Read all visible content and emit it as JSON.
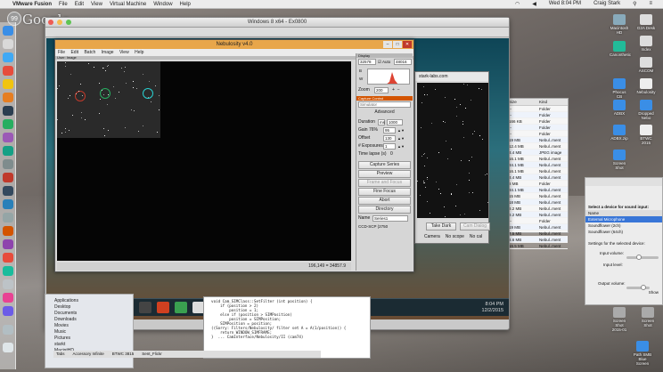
{
  "menubar": {
    "apple": "",
    "items": [
      "VMware Fusion",
      "File",
      "Edit",
      "View",
      "Virtual Machine",
      "Window",
      "Help"
    ],
    "clock": "Wed 8:04 PM",
    "user": "Craig Stark"
  },
  "hangouts": {
    "badge": "99",
    "logo": "Google"
  },
  "vm_window": {
    "title": "Windows 8 x64 - Ex0800"
  },
  "nebulosity": {
    "title": "Nebulosity v4.0",
    "menu": [
      "File",
      "Edit",
      "Batch",
      "Image",
      "View",
      "Help"
    ],
    "subbar": "User: Image",
    "status": "196,149 = 34857.9",
    "display": {
      "header": "Display",
      "black": "32578",
      "white": "48016",
      "auto_label": "Auto",
      "auto_checked": true,
      "b_label": "B",
      "w_label": "W",
      "zoom_label": "Zoom",
      "zoom": "200"
    },
    "capture": {
      "header": "Capture Control",
      "camera": "Simulator",
      "advanced": "Advanced",
      "duration_label": "Duration",
      "duration_unit": "ms",
      "duration": "1000",
      "gain_label": "Gain 76%",
      "gain": "95",
      "offset_label": "Offset",
      "offset": "130",
      "exposures_label": "# Exposures",
      "exposures": "1",
      "timelapse_label": "Time lapse (s)",
      "timelapse": "0",
      "buttons": [
        "Capture Series",
        "Preview",
        "Frame and Focus",
        "Fine Focus",
        "Abort",
        "Directory"
      ],
      "disabled_buttons": [
        "Frame and Focus"
      ],
      "name_label": "Name",
      "name": "Series1",
      "camera_info": "CCD-SCP (2750"
    }
  },
  "otherwin": {
    "title": "stark-labs.com",
    "buttons": [
      "Take Dark",
      "Cam Dialog"
    ],
    "status": [
      "Camera",
      "No scope",
      "No cal"
    ]
  },
  "finder": {
    "cols": [
      "Size",
      "Kind"
    ],
    "rows": [
      [
        "--",
        "Folder"
      ],
      [
        "--",
        "Folder"
      ],
      [
        "166 KB",
        "Folder"
      ],
      [
        "--",
        "Folder"
      ],
      [
        "--",
        "Folder"
      ],
      [
        "19 MB",
        "Nebul..ment"
      ],
      [
        "12.4 MB",
        "Nebul..ment"
      ],
      [
        "3.4 MB",
        "JPEG image"
      ],
      [
        "16.1 MB",
        "Nebul..ment"
      ],
      [
        "34.1 MB",
        "Nebul..ment"
      ],
      [
        "16.1 MB",
        "Nebul..ment"
      ],
      [
        "3.4 MB",
        "Nebul..ment"
      ],
      [
        "8 MB",
        "Folder"
      ],
      [
        "34.1 MB",
        "Nebul..ment"
      ],
      [
        "15 MB",
        "Nebul..ment"
      ],
      [
        "18 MB",
        "Nebul..ment"
      ],
      [
        "8.2 MB",
        "Nebul..ment"
      ],
      [
        "8.2 MB",
        "Nebul..ment"
      ],
      [
        "--",
        "Folder"
      ],
      [
        "19 MB",
        "Nebul..ment"
      ],
      [
        "7.5 MB",
        "Nebul..ment"
      ],
      [
        "8.6 MB",
        "Nebul..ment"
      ],
      [
        "16.5 MB",
        "Nebul..ment"
      ]
    ]
  },
  "sound": {
    "select": "Select a device for sound input:",
    "col_name": "Name",
    "devices": [
      "External Microphone",
      "Soundflower (2ch)",
      "Soundflower (64ch)"
    ],
    "settings": "Settings for the selected device:",
    "input_volume": "Input volume:",
    "input_level": "Input level:",
    "output_volume": "Output volume:",
    "show": "Show",
    "input_volume_value": 0.3,
    "output_volume_value": 0.6
  },
  "code_lines": [
    "  void Cam_SIMClass::SetFilter (int position) {",
    "      if (position > 2)",
    "          position = 1;",
    "      else if (position > SIMPosition)",
    "          position = SIMPosition;",
    "      SIMPosition = position;",
    "  ((Sorry: Filters/Nebulosity/ filter set A = A(1/position)) {",
    "      return WINDOW_SIMFRAME;",
    "  }  ... CamInterface/Nebulosity/II (cam74)"
  ],
  "sidebar": [
    "Applications",
    "Desktop",
    "Documents",
    "Downloads",
    "Movies",
    "Music",
    "Pictures",
    "starkt",
    "MacintHD"
  ],
  "tabs": [
    "Tabs",
    "Accessory Infinite",
    "BTWC 3815",
    "Sent_Flickr"
  ],
  "desktop_icons": [
    "Macintosh HD",
    "G2A Desk",
    "Index",
    "Canonthetic",
    "ASCOM",
    "Phocus CB",
    "Nebulosity",
    "ADBX",
    "Dropped Nebo",
    "ADBX.zip",
    "BTWC 2015",
    "Screen Shot",
    "Screen Shot 2015-01",
    "Screen Shot",
    "Path SMB Blue Screen"
  ],
  "taskbar_clock": [
    "8:04 PM",
    "12/2/2015"
  ],
  "colors": {
    "nebulosity_title": "#e8a64a",
    "circle_red": "#c0392b",
    "circle_green": "#27ae60",
    "circle_cyan": "#29d0d0"
  }
}
